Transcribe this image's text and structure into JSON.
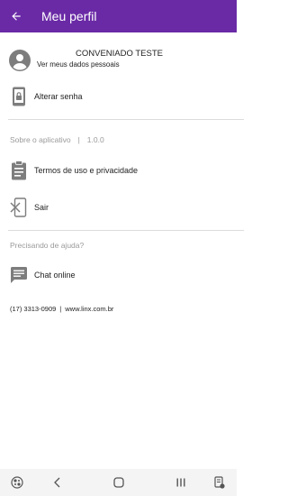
{
  "appbar": {
    "title": "Meu perfil",
    "color": "#6a2aa6"
  },
  "profile": {
    "name": "CONVENIADO TESTE",
    "subtitle": "Ver meus dados pessoais"
  },
  "menu": {
    "change_password": "Alterar senha",
    "terms": "Termos de uso e privacidade",
    "logout": "Sair",
    "chat": "Chat online"
  },
  "about": {
    "label": "Sobre o aplicativo",
    "separator": "|",
    "version": "1.0.0"
  },
  "help": {
    "label": "Precisando de ajuda?"
  },
  "contact": {
    "phone": "(17) 3313-0909",
    "separator": "|",
    "website": "www.linx.com.br"
  },
  "icons": {
    "back": "arrow-left-icon",
    "avatar": "account-circle-icon",
    "password": "phone-lock-icon",
    "terms": "clipboard-icon",
    "logout": "exit-icon",
    "chat": "chat-icon"
  }
}
